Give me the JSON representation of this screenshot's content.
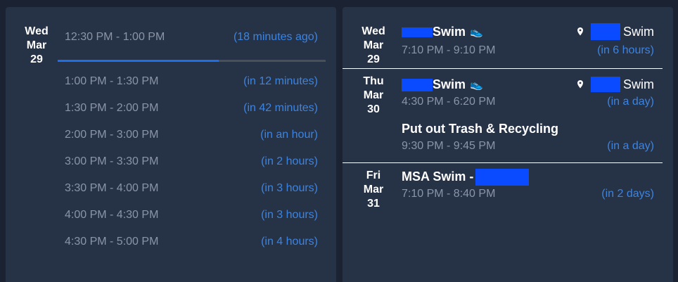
{
  "left": {
    "date": {
      "weekday": "Wed",
      "month": "Mar",
      "day": "29"
    },
    "current_slot": {
      "time": "12:30 PM - 1:00 PM",
      "relative": "(18 minutes ago)",
      "progress": 0.6
    },
    "slots": [
      {
        "time": "1:00 PM - 1:30 PM",
        "relative": "(in 12 minutes)"
      },
      {
        "time": "1:30 PM - 2:00 PM",
        "relative": "(in 42 minutes)"
      },
      {
        "time": "2:00 PM - 3:00 PM",
        "relative": "(in an hour)"
      },
      {
        "time": "3:00 PM - 3:30 PM",
        "relative": "(in 2 hours)"
      },
      {
        "time": "3:30 PM - 4:00 PM",
        "relative": "(in 3 hours)"
      },
      {
        "time": "4:00 PM - 4:30 PM",
        "relative": "(in 3 hours)"
      },
      {
        "time": "4:30 PM - 5:00 PM",
        "relative": "(in 4 hours)"
      }
    ]
  },
  "right": {
    "groups": [
      {
        "date": {
          "weekday": "Wed",
          "month": "Mar",
          "day": "29"
        },
        "events": [
          {
            "title": "Swim",
            "icon": "running-shoe-icon",
            "time": "7:10 PM - 9:10 PM",
            "relative": "(in 6 hours)",
            "location": "Swim"
          }
        ]
      },
      {
        "date": {
          "weekday": "Thu",
          "month": "Mar",
          "day": "30"
        },
        "events": [
          {
            "title": "Swim",
            "icon": "running-shoe-icon",
            "time": "4:30 PM - 6:20 PM",
            "relative": "(in a day)",
            "location": "Swim"
          },
          {
            "title": "Put out Trash & Recycling",
            "time": "9:30 PM - 9:45 PM",
            "relative": "(in a day)"
          }
        ]
      },
      {
        "date": {
          "weekday": "Fri",
          "month": "Mar",
          "day": "31"
        },
        "events": [
          {
            "title": "MSA Swim -",
            "time": "7:10 PM - 8:40 PM",
            "relative": "(in 2 days)"
          }
        ]
      }
    ]
  },
  "colors": {
    "panel_bg": "#263246",
    "page_bg": "#1b2231",
    "accent": "#3d84e0",
    "muted": "#8a95a8",
    "progress": "#1e6ee8",
    "redaction": "#0a4bff"
  }
}
